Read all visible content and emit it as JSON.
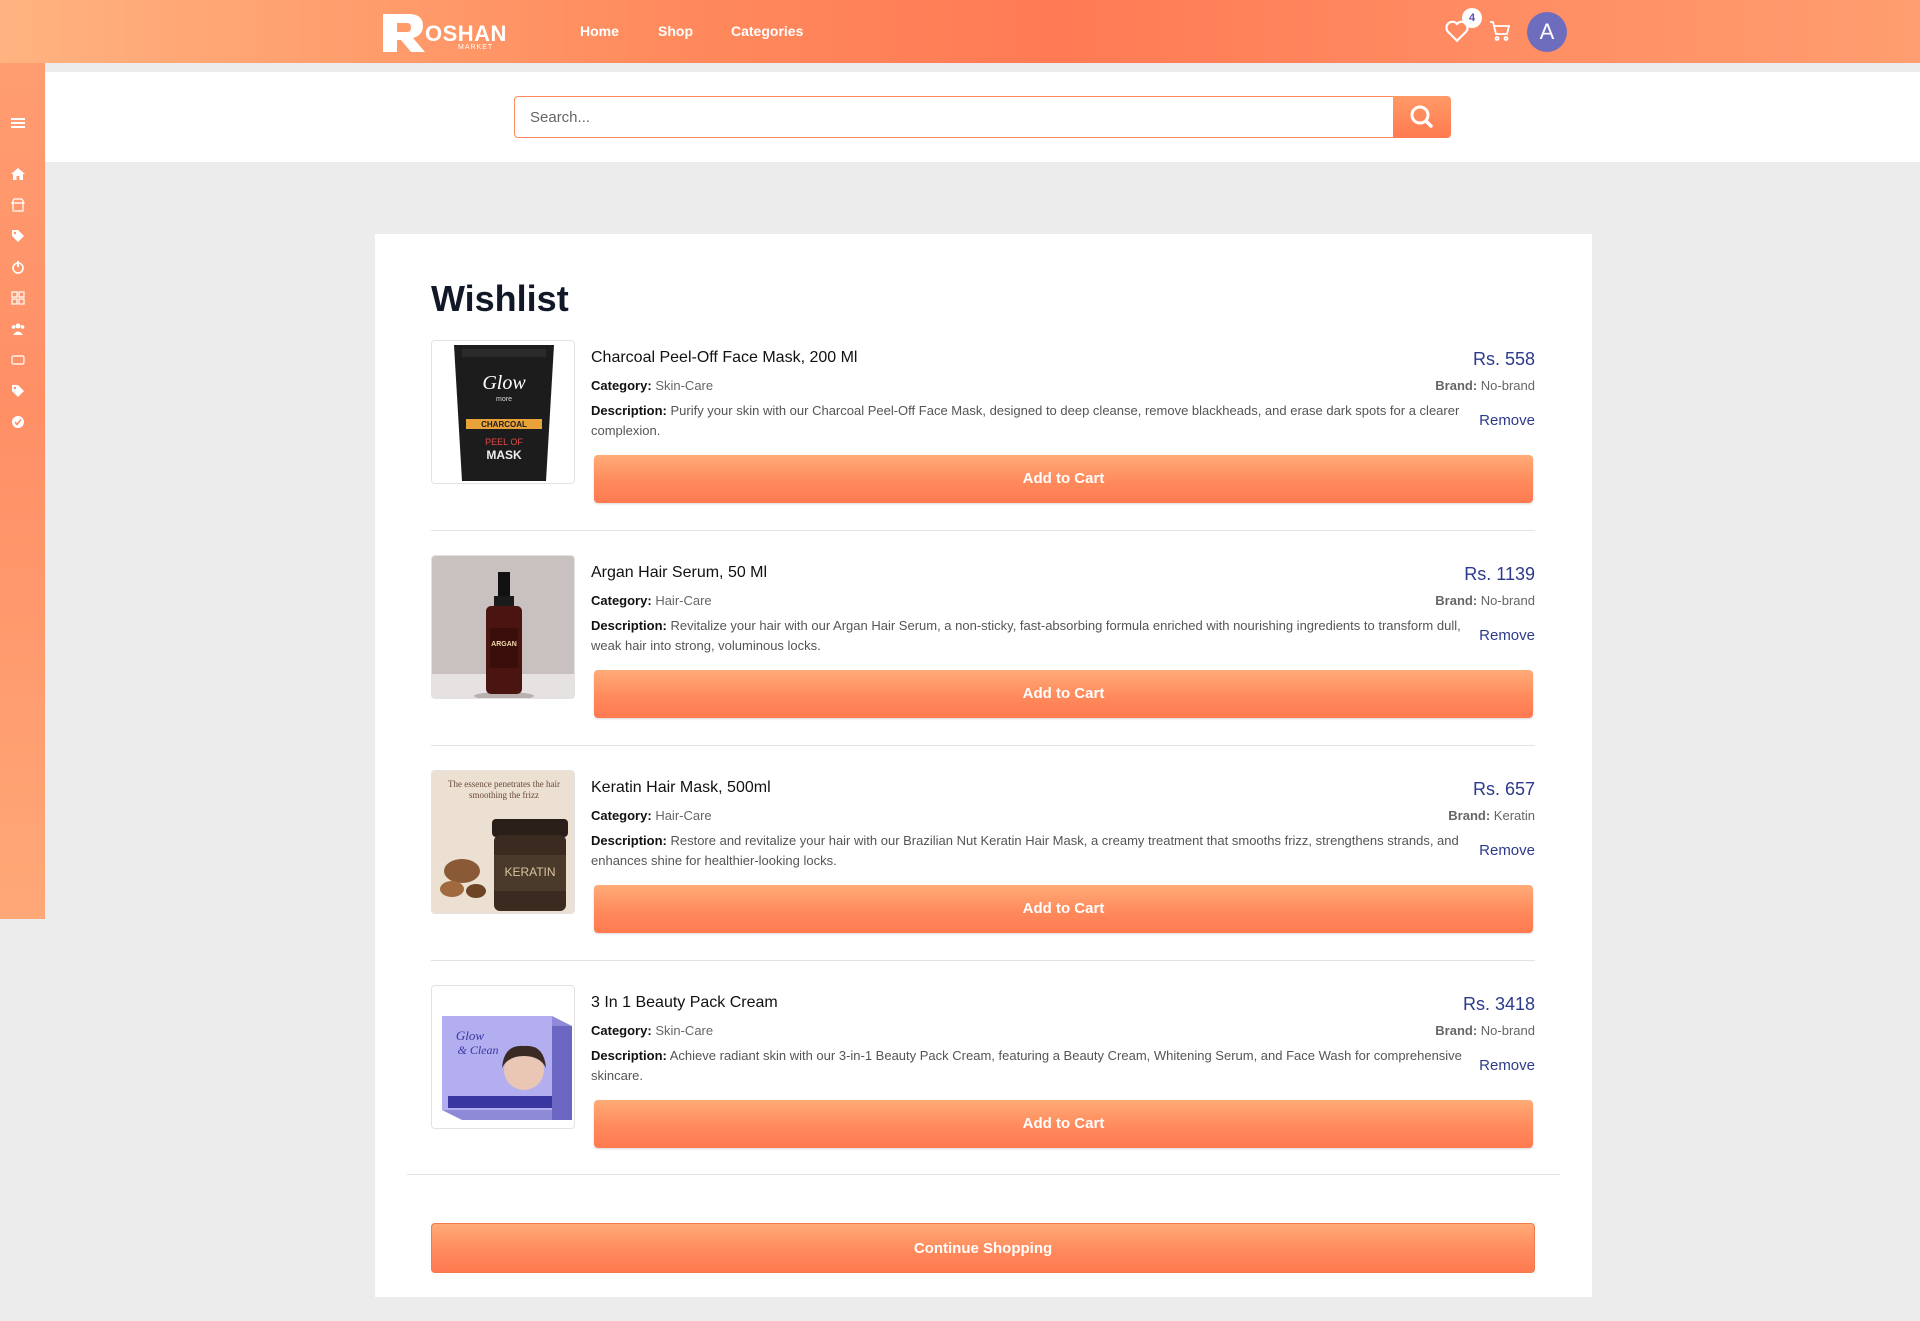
{
  "header": {
    "logo_text": "OSHAN",
    "logo_sub": "MARKET",
    "nav": [
      "Home",
      "Shop",
      "Categories"
    ],
    "wishlist_count": "4",
    "avatar_letter": "A"
  },
  "sidebar": {
    "icons": [
      "menu-icon",
      "home-icon",
      "store-icon",
      "tags-icon",
      "brand-icon",
      "grid-icon",
      "users-icon",
      "card-icon",
      "tag-icon",
      "check-circle-icon"
    ]
  },
  "search": {
    "placeholder": "Search..."
  },
  "page": {
    "title": "Wishlist",
    "category_label": "Category:",
    "brand_label": "Brand:",
    "description_label": "Description:",
    "remove_label": "Remove",
    "add_to_cart_label": "Add to Cart",
    "continue_label": "Continue Shopping"
  },
  "items": [
    {
      "name": "Charcoal Peel-Off Face Mask, 200 Ml",
      "price": "Rs. 558",
      "category": "Skin-Care",
      "brand": "No-brand",
      "description": "Purify your skin with our Charcoal Peel-Off Face Mask, designed to deep cleanse, remove blackheads, and erase dark spots for a clearer complexion.",
      "image": "charcoal-mask-tube"
    },
    {
      "name": "Argan Hair Serum, 50 Ml",
      "price": "Rs. 1139",
      "category": "Hair-Care",
      "brand": "No-brand",
      "description": "Revitalize your hair with our Argan Hair Serum, a non-sticky, fast-absorbing formula enriched with nourishing ingredients to transform dull, weak hair into strong, voluminous locks.",
      "image": "argan-serum-bottle"
    },
    {
      "name": "Keratin Hair Mask, 500ml",
      "price": "Rs. 657",
      "category": "Hair-Care",
      "brand": "Keratin",
      "description": "Restore and revitalize your hair with our Brazilian Nut Keratin Hair Mask, a creamy treatment that smooths frizz, strengthens strands, and enhances shine for healthier-looking locks.",
      "image": "keratin-jar"
    },
    {
      "name": "3 In 1 Beauty Pack Cream",
      "price": "Rs. 3418",
      "category": "Skin-Care",
      "brand": "No-brand",
      "description": "Achieve radiant skin with our 3-in-1 Beauty Pack Cream, featuring a Beauty Cream, Whitening Serum, and Face Wash for comprehensive skincare.",
      "image": "beauty-pack-box"
    }
  ],
  "colors": {
    "accent": "#ff8a5c",
    "price": "#2d3a8c",
    "avatar": "#6e6dbd"
  }
}
